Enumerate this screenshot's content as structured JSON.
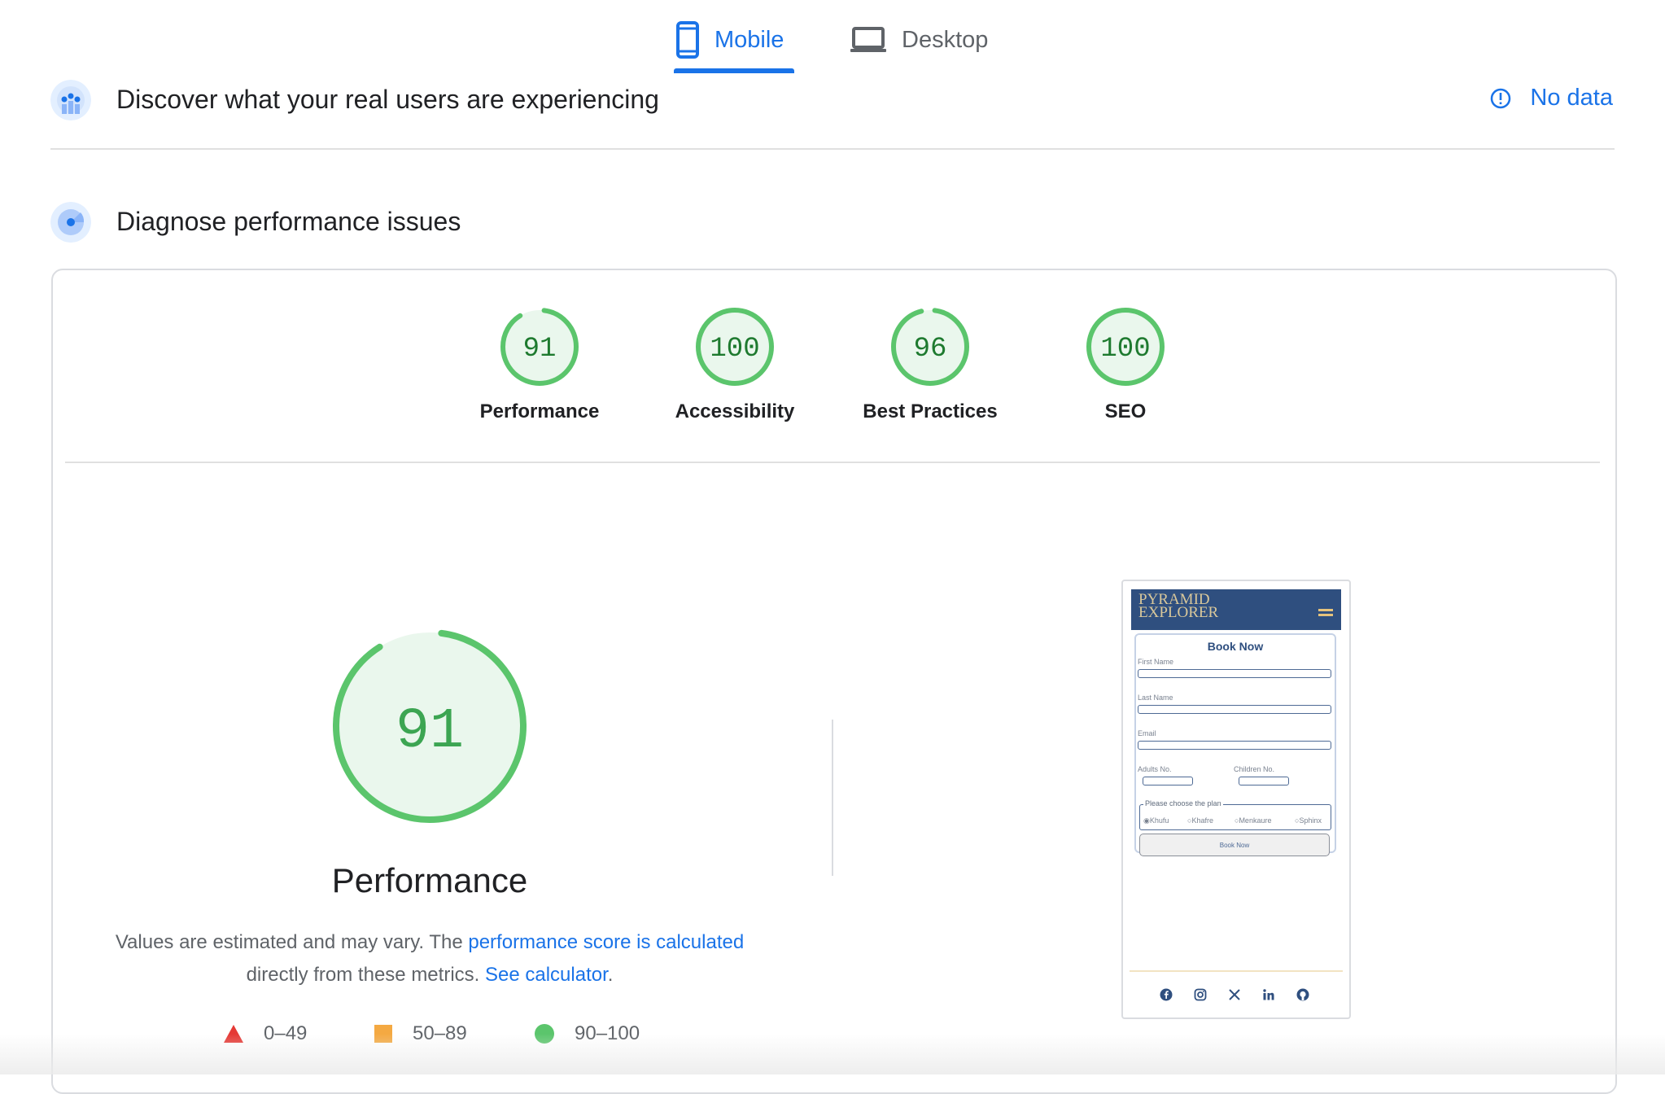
{
  "tabs": [
    {
      "label": "Mobile",
      "icon": "smartphone-icon",
      "selected": true
    },
    {
      "label": "Desktop",
      "icon": "laptop-icon",
      "selected": false
    }
  ],
  "field_data": {
    "title": "Discover what your real users are experiencing",
    "status": "No data",
    "status_icon": "info-icon"
  },
  "diagnose": {
    "title": "Diagnose performance issues"
  },
  "scores": [
    {
      "label": "Performance",
      "value": "91",
      "fraction": 0.91
    },
    {
      "label": "Accessibility",
      "value": "100",
      "fraction": 1.0
    },
    {
      "label": "Best Practices",
      "value": "96",
      "fraction": 0.96
    },
    {
      "label": "SEO",
      "value": "100",
      "fraction": 1.0
    }
  ],
  "main_score": {
    "value": "91",
    "fraction": 0.91,
    "title": "Performance",
    "desc_prefix": "Values are estimated and may vary. The ",
    "desc_link1": "performance score is calculated",
    "desc_middle": " directly from these metrics. ",
    "desc_link2": "See calculator",
    "desc_suffix": "."
  },
  "legend": [
    {
      "range": "0–49",
      "shape": "triangle",
      "color": "#e53935"
    },
    {
      "range": "50–89",
      "shape": "square",
      "color": "#f4a942"
    },
    {
      "range": "90–100",
      "shape": "circle",
      "color": "#5bc56c"
    }
  ],
  "colors": {
    "accent": "#1a73e8",
    "pass": "#5bc56c",
    "pass_text": "#1e7a2f",
    "pass_bg": "#eaf7ed"
  },
  "preview": {
    "logo_line1": "PYRAMID",
    "logo_line2": "EXPLORER",
    "form_title": "Book Now",
    "first_name": "First Name",
    "last_name": "Last Name",
    "email": "Email",
    "adults": "Adults No.",
    "children": "Children No.",
    "plan_legend": "Please choose the plan",
    "plans": [
      "Khufu",
      "Khafre",
      "Menkaure",
      "Sphinx"
    ],
    "submit": "Book Now",
    "social_icons": [
      "facebook-icon",
      "instagram-icon",
      "x-icon",
      "linkedin-icon",
      "github-icon"
    ]
  }
}
